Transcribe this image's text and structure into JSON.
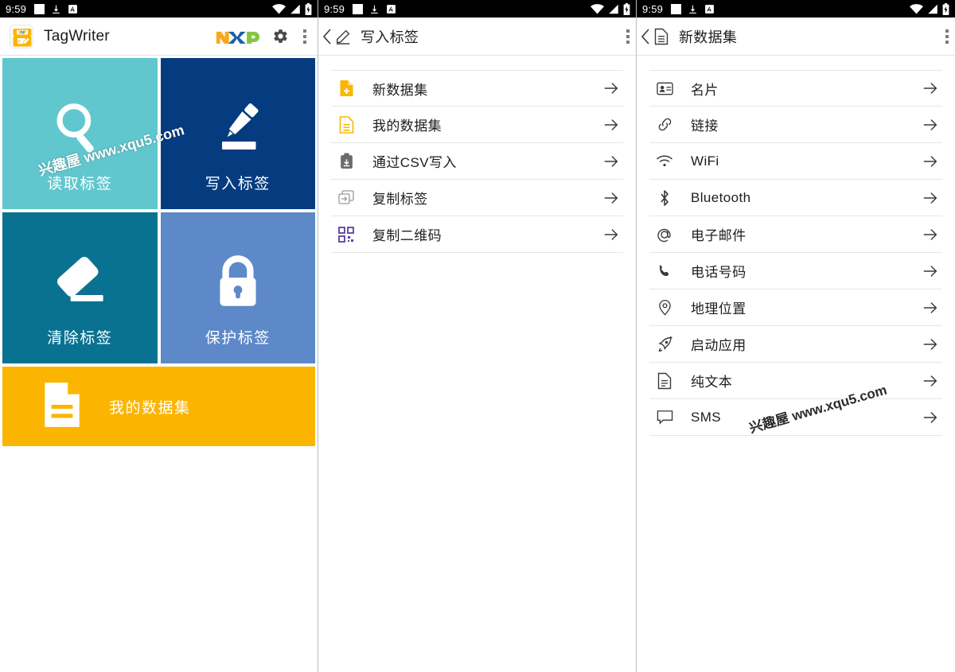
{
  "colors": {
    "read_tile": "#61c7ce",
    "write_tile": "#053c80",
    "erase_tile": "#0a7291",
    "protect_tile": "#5d89c8",
    "mydatasets_tile": "#fbb500",
    "accent_amber": "#fbb500",
    "qr_purple": "#5b3e9e",
    "statusbar": "#000000",
    "text": "#1d1d1d"
  },
  "statusbar": {
    "time": "9:59",
    "left_icons": [
      "white-square-icon",
      "download-icon",
      "a-box-icon"
    ],
    "right_icons": [
      "wifi-icon",
      "signal-icon",
      "battery-charging-icon"
    ]
  },
  "screen1": {
    "appbar": {
      "app_icon": "tagwriter-app-icon",
      "title": "TagWriter",
      "brand_logo": "nxp-logo",
      "settings_icon": "gear-icon",
      "overflow_icon": "kebab-menu-icon"
    },
    "tiles": [
      {
        "label": "读取标签",
        "icon": "magnifier-icon",
        "color": "#61c7ce"
      },
      {
        "label": "写入标签",
        "icon": "pen-tag-icon",
        "color": "#053c80"
      },
      {
        "label": "清除标签",
        "icon": "eraser-icon",
        "color": "#0a7291"
      },
      {
        "label": "保护标签",
        "icon": "lock-icon",
        "color": "#5d89c8"
      }
    ],
    "wide_tile": {
      "label": "我的数据集",
      "icon": "document-icon",
      "color": "#fbb500"
    },
    "watermark": "兴趣屋 www.xqu5.com"
  },
  "screen2": {
    "subbar": {
      "back_icon": "chevron-left-icon",
      "icon": "pen-edit-icon",
      "title": "写入标签",
      "overflow_icon": "kebab-menu-icon"
    },
    "rows": [
      {
        "label": "新数据集",
        "icon": "new-dataset-icon"
      },
      {
        "label": "我的数据集",
        "icon": "my-datasets-icon"
      },
      {
        "label": "通过CSV写入",
        "icon": "csv-import-icon"
      },
      {
        "label": "复制标签",
        "icon": "copy-tag-icon"
      },
      {
        "label": "复制二维码",
        "icon": "qr-code-icon"
      }
    ]
  },
  "screen3": {
    "subbar": {
      "back_icon": "chevron-left-icon",
      "icon": "document-outline-icon",
      "title": "新数据集",
      "overflow_icon": "kebab-menu-icon"
    },
    "rows": [
      {
        "label": "名片",
        "icon": "contact-card-icon"
      },
      {
        "label": "链接",
        "icon": "link-icon"
      },
      {
        "label": "WiFi",
        "icon": "wifi-icon"
      },
      {
        "label": "Bluetooth",
        "icon": "bluetooth-icon"
      },
      {
        "label": "电子邮件",
        "icon": "email-at-icon"
      },
      {
        "label": "电话号码",
        "icon": "phone-icon"
      },
      {
        "label": "地理位置",
        "icon": "location-pin-icon"
      },
      {
        "label": "启动应用",
        "icon": "rocket-launch-icon"
      },
      {
        "label": "纯文本",
        "icon": "plain-text-icon"
      },
      {
        "label": "SMS",
        "icon": "sms-bubble-icon"
      }
    ],
    "watermark": "兴趣屋 www.xqu5.com"
  }
}
